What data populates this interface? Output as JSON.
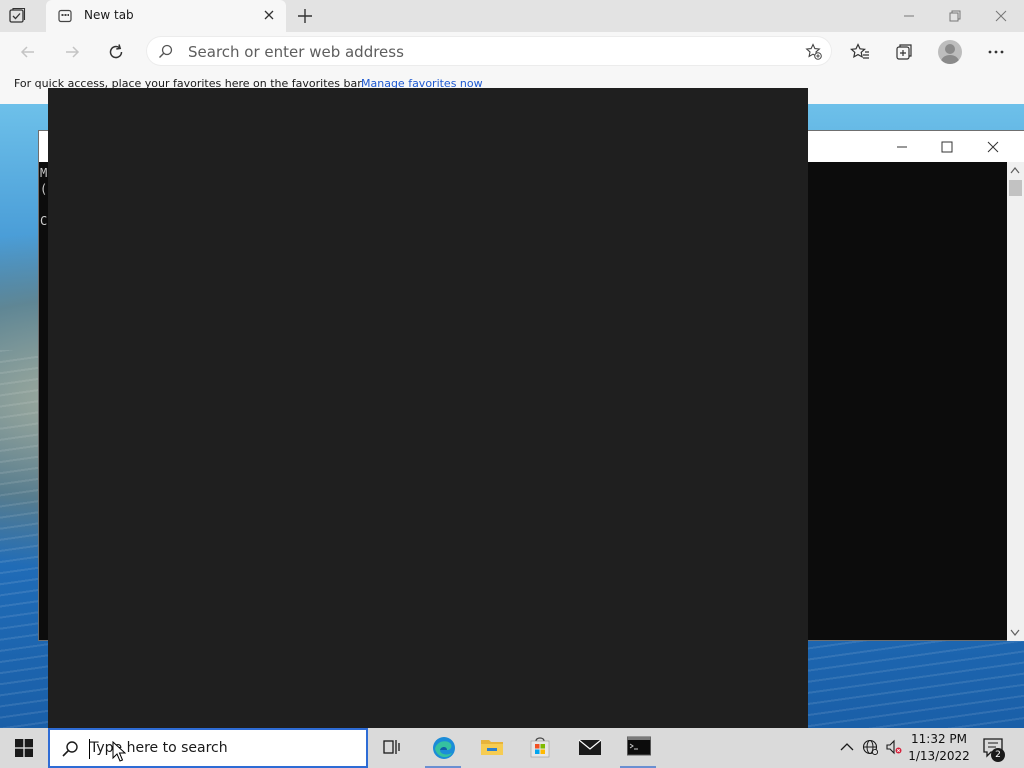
{
  "browser": {
    "tab": {
      "title": "New tab"
    },
    "address": {
      "placeholder": "Search or enter web address"
    },
    "favorites_bar": {
      "message": "For quick access, place your favorites here on the favorites bar.",
      "link": "Manage favorites now"
    }
  },
  "console": {
    "lines": [
      "M",
      "(",
      "",
      "C"
    ]
  },
  "taskbar": {
    "search_placeholder": "Type here to search",
    "clock": {
      "time": "11:32 PM",
      "date": "1/13/2022"
    },
    "notification_count": "2",
    "apps": [
      "task-view",
      "edge",
      "file-explorer",
      "store",
      "mail",
      "terminal"
    ]
  },
  "colors": {
    "overlay": "#1f1f1f",
    "console_bg": "#0c0c0c",
    "accent": "#2e6cd5",
    "link": "#1f5ad1"
  }
}
